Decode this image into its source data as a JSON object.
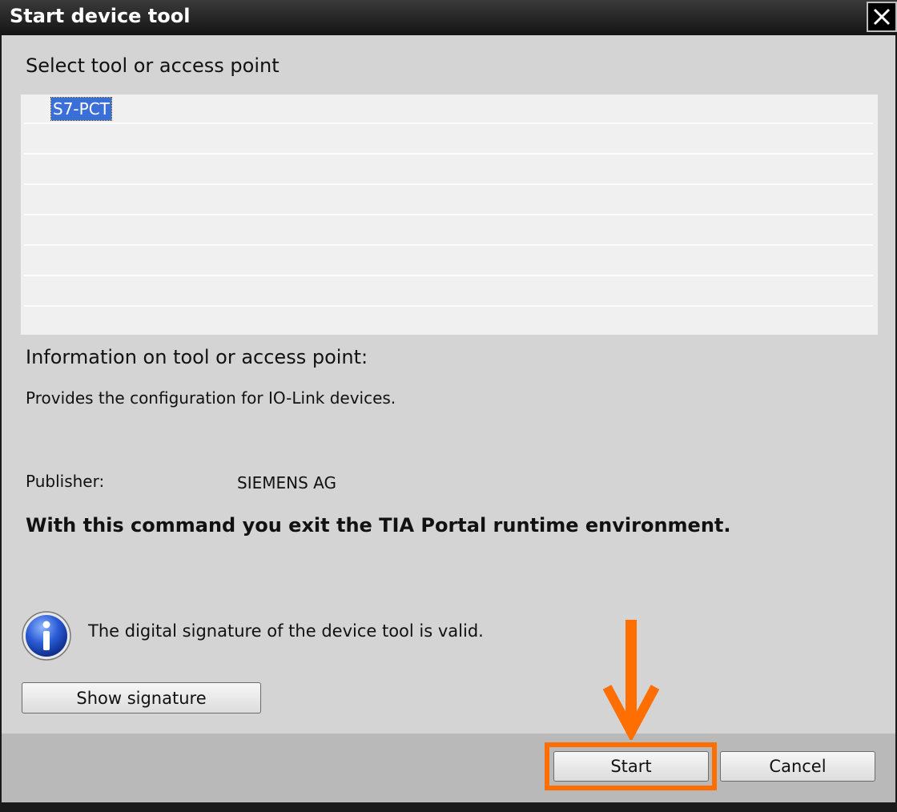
{
  "window": {
    "title": "Start device tool",
    "close_icon": "close-icon"
  },
  "select_section": {
    "heading": "Select tool or access point",
    "items": [
      {
        "label": "S7-PCT",
        "selected": true
      }
    ]
  },
  "info_section": {
    "heading": "Information on tool or access point:",
    "description": "Provides the configuration for IO-Link devices.",
    "publisher_label": "Publisher:",
    "publisher_value": "SIEMENS AG",
    "warning": "With this command you exit the TIA Portal runtime environment."
  },
  "signature": {
    "icon": "info-icon",
    "text": "The digital signature of the device tool is valid.",
    "show_button": "Show signature"
  },
  "footer": {
    "start_label": "Start",
    "cancel_label": "Cancel"
  },
  "annotation": {
    "arrow_icon": "arrow-down-icon",
    "color": "#ff6e00"
  },
  "colors": {
    "selection": "#3a6fd8",
    "body": "#d4d4d4",
    "titlebar": "#1c1c1c"
  }
}
